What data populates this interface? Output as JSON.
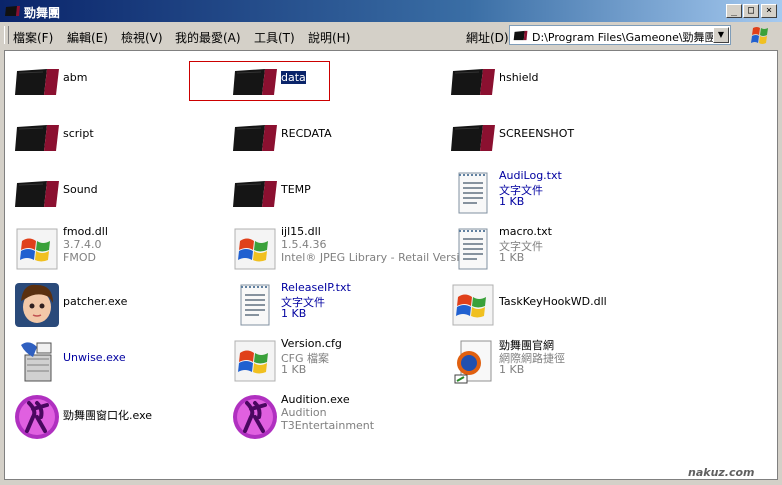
{
  "window": {
    "title": "勁舞團"
  },
  "menu": [
    "檔案(F)",
    "編輯(E)",
    "檢視(V)",
    "我的最愛(A)",
    "工具(T)",
    "說明(H)"
  ],
  "address": {
    "label": "網址(D)",
    "path": "D:\\Program Files\\Gameone\\勁舞團"
  },
  "items": [
    {
      "name": "abm"
    },
    {
      "name": "data"
    },
    {
      "name": "hshield"
    },
    {
      "name": "script"
    },
    {
      "name": "RECDATA"
    },
    {
      "name": "SCREENSHOT"
    },
    {
      "name": "Sound"
    },
    {
      "name": "TEMP"
    },
    {
      "name": "AudiLog.txt",
      "type": "文字文件",
      "size": "1 KB"
    },
    {
      "name": "fmod.dll",
      "version": "3.7.4.0",
      "desc": "FMOD"
    },
    {
      "name": "ijl15.dll",
      "version": "1.5.4.36",
      "desc": "Intel® JPEG Library - Retail Version"
    },
    {
      "name": "macro.txt",
      "type": "文字文件",
      "size": "1 KB"
    },
    {
      "name": "patcher.exe"
    },
    {
      "name": "ReleaseIP.txt",
      "type": "文字文件",
      "size": "1 KB"
    },
    {
      "name": "TaskKeyHookWD.dll"
    },
    {
      "name": "Unwise.exe"
    },
    {
      "name": "Version.cfg",
      "type": "CFG 檔案",
      "size": "1 KB"
    },
    {
      "name": "勁舞團官網",
      "type": "網際網路捷徑",
      "size": "1 KB"
    },
    {
      "name": "勁舞團窗口化.exe"
    },
    {
      "name": "Audition.exe",
      "product": "Audition",
      "company": "T3Entertainment"
    }
  ],
  "watermark": "nakuz.com"
}
